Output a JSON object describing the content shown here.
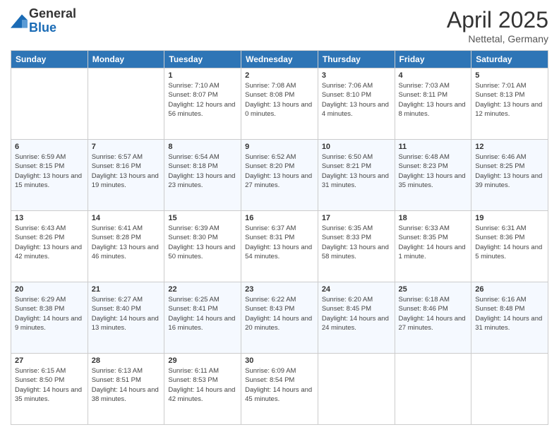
{
  "logo": {
    "general": "General",
    "blue": "Blue"
  },
  "header": {
    "month": "April 2025",
    "location": "Nettetal, Germany"
  },
  "weekdays": [
    "Sunday",
    "Monday",
    "Tuesday",
    "Wednesday",
    "Thursday",
    "Friday",
    "Saturday"
  ],
  "weeks": [
    [
      {
        "day": "",
        "info": ""
      },
      {
        "day": "",
        "info": ""
      },
      {
        "day": "1",
        "info": "Sunrise: 7:10 AM\nSunset: 8:07 PM\nDaylight: 12 hours and 56 minutes."
      },
      {
        "day": "2",
        "info": "Sunrise: 7:08 AM\nSunset: 8:08 PM\nDaylight: 13 hours and 0 minutes."
      },
      {
        "day": "3",
        "info": "Sunrise: 7:06 AM\nSunset: 8:10 PM\nDaylight: 13 hours and 4 minutes."
      },
      {
        "day": "4",
        "info": "Sunrise: 7:03 AM\nSunset: 8:11 PM\nDaylight: 13 hours and 8 minutes."
      },
      {
        "day": "5",
        "info": "Sunrise: 7:01 AM\nSunset: 8:13 PM\nDaylight: 13 hours and 12 minutes."
      }
    ],
    [
      {
        "day": "6",
        "info": "Sunrise: 6:59 AM\nSunset: 8:15 PM\nDaylight: 13 hours and 15 minutes."
      },
      {
        "day": "7",
        "info": "Sunrise: 6:57 AM\nSunset: 8:16 PM\nDaylight: 13 hours and 19 minutes."
      },
      {
        "day": "8",
        "info": "Sunrise: 6:54 AM\nSunset: 8:18 PM\nDaylight: 13 hours and 23 minutes."
      },
      {
        "day": "9",
        "info": "Sunrise: 6:52 AM\nSunset: 8:20 PM\nDaylight: 13 hours and 27 minutes."
      },
      {
        "day": "10",
        "info": "Sunrise: 6:50 AM\nSunset: 8:21 PM\nDaylight: 13 hours and 31 minutes."
      },
      {
        "day": "11",
        "info": "Sunrise: 6:48 AM\nSunset: 8:23 PM\nDaylight: 13 hours and 35 minutes."
      },
      {
        "day": "12",
        "info": "Sunrise: 6:46 AM\nSunset: 8:25 PM\nDaylight: 13 hours and 39 minutes."
      }
    ],
    [
      {
        "day": "13",
        "info": "Sunrise: 6:43 AM\nSunset: 8:26 PM\nDaylight: 13 hours and 42 minutes."
      },
      {
        "day": "14",
        "info": "Sunrise: 6:41 AM\nSunset: 8:28 PM\nDaylight: 13 hours and 46 minutes."
      },
      {
        "day": "15",
        "info": "Sunrise: 6:39 AM\nSunset: 8:30 PM\nDaylight: 13 hours and 50 minutes."
      },
      {
        "day": "16",
        "info": "Sunrise: 6:37 AM\nSunset: 8:31 PM\nDaylight: 13 hours and 54 minutes."
      },
      {
        "day": "17",
        "info": "Sunrise: 6:35 AM\nSunset: 8:33 PM\nDaylight: 13 hours and 58 minutes."
      },
      {
        "day": "18",
        "info": "Sunrise: 6:33 AM\nSunset: 8:35 PM\nDaylight: 14 hours and 1 minute."
      },
      {
        "day": "19",
        "info": "Sunrise: 6:31 AM\nSunset: 8:36 PM\nDaylight: 14 hours and 5 minutes."
      }
    ],
    [
      {
        "day": "20",
        "info": "Sunrise: 6:29 AM\nSunset: 8:38 PM\nDaylight: 14 hours and 9 minutes."
      },
      {
        "day": "21",
        "info": "Sunrise: 6:27 AM\nSunset: 8:40 PM\nDaylight: 14 hours and 13 minutes."
      },
      {
        "day": "22",
        "info": "Sunrise: 6:25 AM\nSunset: 8:41 PM\nDaylight: 14 hours and 16 minutes."
      },
      {
        "day": "23",
        "info": "Sunrise: 6:22 AM\nSunset: 8:43 PM\nDaylight: 14 hours and 20 minutes."
      },
      {
        "day": "24",
        "info": "Sunrise: 6:20 AM\nSunset: 8:45 PM\nDaylight: 14 hours and 24 minutes."
      },
      {
        "day": "25",
        "info": "Sunrise: 6:18 AM\nSunset: 8:46 PM\nDaylight: 14 hours and 27 minutes."
      },
      {
        "day": "26",
        "info": "Sunrise: 6:16 AM\nSunset: 8:48 PM\nDaylight: 14 hours and 31 minutes."
      }
    ],
    [
      {
        "day": "27",
        "info": "Sunrise: 6:15 AM\nSunset: 8:50 PM\nDaylight: 14 hours and 35 minutes."
      },
      {
        "day": "28",
        "info": "Sunrise: 6:13 AM\nSunset: 8:51 PM\nDaylight: 14 hours and 38 minutes."
      },
      {
        "day": "29",
        "info": "Sunrise: 6:11 AM\nSunset: 8:53 PM\nDaylight: 14 hours and 42 minutes."
      },
      {
        "day": "30",
        "info": "Sunrise: 6:09 AM\nSunset: 8:54 PM\nDaylight: 14 hours and 45 minutes."
      },
      {
        "day": "",
        "info": ""
      },
      {
        "day": "",
        "info": ""
      },
      {
        "day": "",
        "info": ""
      }
    ]
  ]
}
